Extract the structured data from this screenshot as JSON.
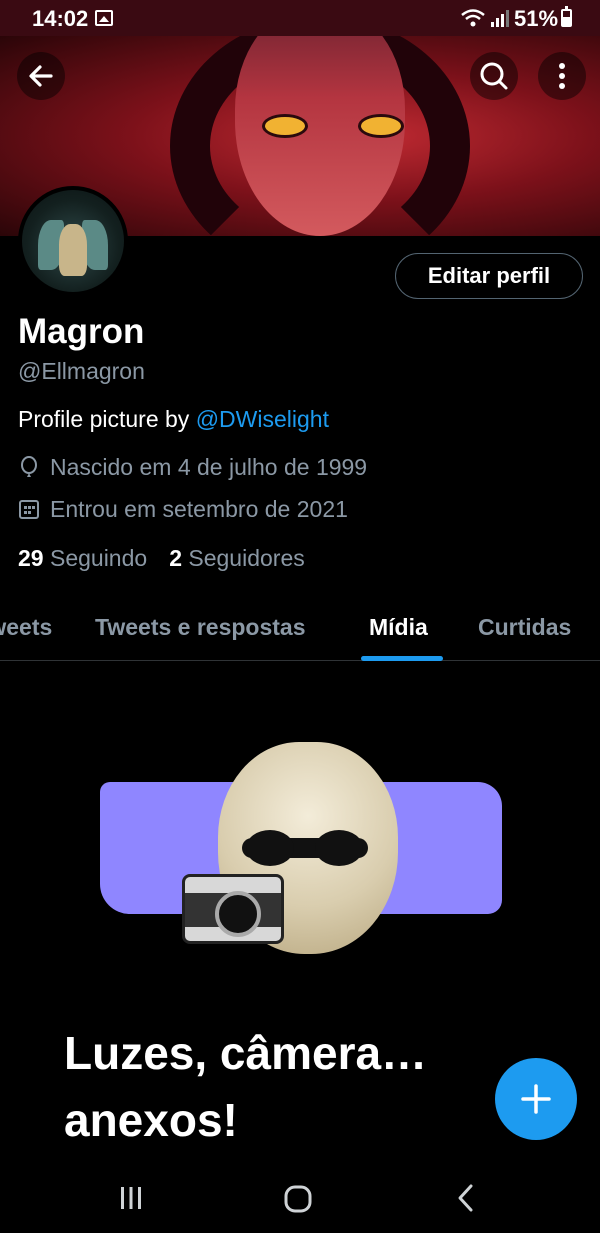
{
  "status_bar": {
    "time": "14:02",
    "battery": "51%"
  },
  "profile": {
    "name": "Magron",
    "handle": "@Ellmagron",
    "bio_prefix": "Profile picture by ",
    "bio_mention": "@DWiselight",
    "birth": "Nascido em 4 de julho de 1999",
    "joined": "Entrou em setembro de 2021",
    "following_count": "29",
    "following_label": "Seguindo",
    "followers_count": "2",
    "followers_label": "Seguidores",
    "edit_button": "Editar perfil"
  },
  "tabs": [
    {
      "label": "Tweets"
    },
    {
      "label": "Tweets e respostas"
    },
    {
      "label": "Mídia"
    },
    {
      "label": "Curtidas"
    }
  ],
  "active_tab": "Mídia",
  "empty_state": {
    "title_line1": "Luzes, câmera…",
    "title_line2": "anexos!"
  },
  "colors": {
    "accent": "#1d9bf0",
    "background": "#000000",
    "secondary_text": "#8b98a5"
  }
}
